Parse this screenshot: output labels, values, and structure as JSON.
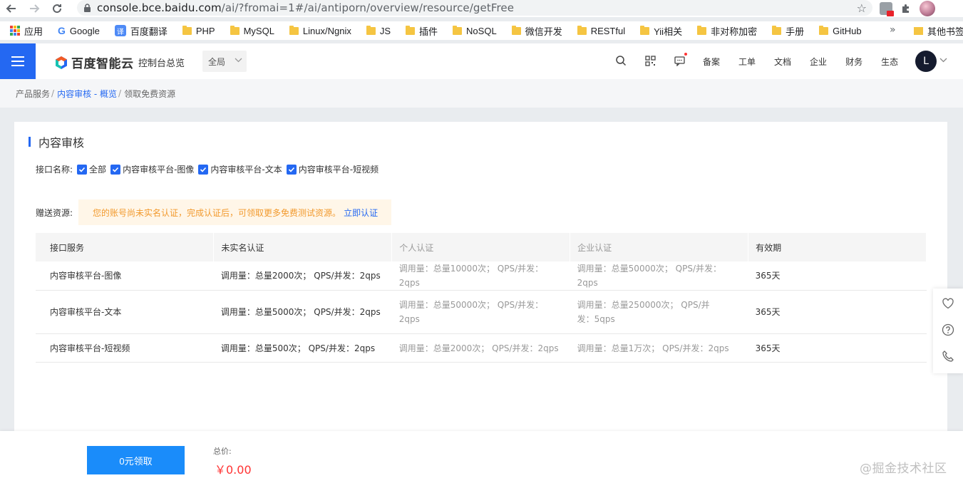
{
  "browser": {
    "url_host": "console.bce.baidu.com",
    "url_path": "/ai/?fromai=1#/ai/antiporn/overview/resource/getFree",
    "bookmarks": [
      {
        "label": "应用",
        "icon": "apps-icon"
      },
      {
        "label": "Google",
        "icon": "google-icon"
      },
      {
        "label": "百度翻译",
        "icon": "baidu-translate-icon"
      },
      {
        "label": "PHP",
        "icon": "folder-icon"
      },
      {
        "label": "MySQL",
        "icon": "folder-icon"
      },
      {
        "label": "Linux/Ngnix",
        "icon": "folder-icon"
      },
      {
        "label": "JS",
        "icon": "folder-icon"
      },
      {
        "label": "插件",
        "icon": "folder-icon"
      },
      {
        "label": "NoSQL",
        "icon": "folder-icon"
      },
      {
        "label": "微信开发",
        "icon": "folder-icon"
      },
      {
        "label": "RESTful",
        "icon": "folder-icon"
      },
      {
        "label": "Yii相关",
        "icon": "folder-icon"
      },
      {
        "label": "非对称加密",
        "icon": "folder-icon"
      },
      {
        "label": "手册",
        "icon": "folder-icon"
      },
      {
        "label": "GitHub",
        "icon": "folder-icon"
      }
    ],
    "bookmarks_more": "»",
    "other_bookmarks": "其他书签"
  },
  "header": {
    "logo_text": "百度智能云",
    "console_link": "控制台总览",
    "region": "全局",
    "nav": [
      "备案",
      "工单",
      "文档",
      "企业",
      "财务",
      "生态"
    ],
    "user_initial": "L"
  },
  "breadcrumb": {
    "items": [
      "产品服务",
      "内容审核 - 概览",
      "领取免费资源"
    ],
    "separator": "/"
  },
  "card": {
    "title": "内容审核",
    "interface_label": "接口名称:",
    "checkboxes": [
      {
        "label": "全部",
        "checked": true
      },
      {
        "label": "内容审核平台-图像",
        "checked": true
      },
      {
        "label": "内容审核平台-文本",
        "checked": true
      },
      {
        "label": "内容审核平台-短视频",
        "checked": true
      }
    ],
    "gift_label": "赠送资源:",
    "notice_text": "您的账号尚未实名认证，完成认证后，可领取更多免费测试资源。",
    "notice_link": "立即认证"
  },
  "table": {
    "headers": [
      "接口服务",
      "未实名认证",
      "个人认证",
      "企业认证",
      "有效期"
    ],
    "rows": [
      [
        "内容审核平台-图像",
        "调用量：总量2000次； QPS/并发：2qps",
        "调用量：总量10000次； QPS/并发：2qps",
        "调用量：总量50000次； QPS/并发：2qps",
        "365天"
      ],
      [
        "内容审核平台-文本",
        "调用量：总量5000次； QPS/并发：2qps",
        "调用量：总量50000次； QPS/并发：2qps",
        "调用量：总量250000次； QPS/并发：5qps",
        "365天"
      ],
      [
        "内容审核平台-短视频",
        "调用量：总量500次； QPS/并发：2qps",
        "调用量：总量2000次； QPS/并发：2qps",
        "调用量：总量1万次； QPS/并发：2qps",
        "365天"
      ]
    ]
  },
  "bottom": {
    "claim_button": "0元领取",
    "total_label": "总价:",
    "total_value": "￥0.00",
    "watermark": "@掘金技术社区"
  },
  "colors": {
    "primary": "#2468f2",
    "button": "#1a8cfa",
    "warning_text": "#f29a2e",
    "price": "#ff3333"
  }
}
